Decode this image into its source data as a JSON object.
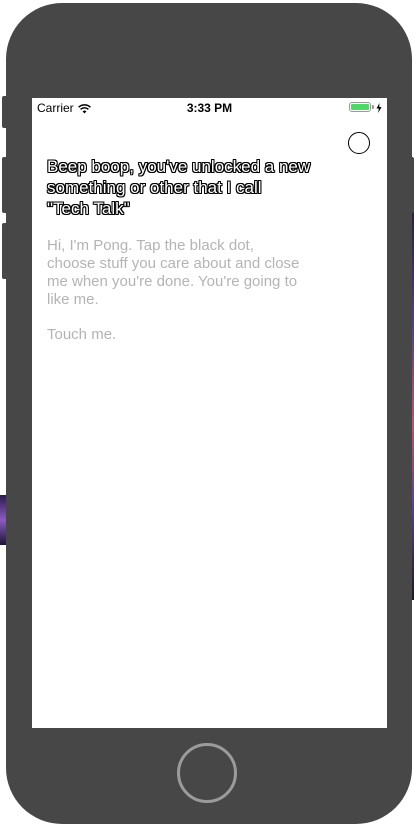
{
  "status_bar": {
    "carrier": "Carrier",
    "time": "3:33 PM",
    "wifi_icon": "wifi-icon",
    "battery_icon": "battery-full-icon",
    "charging_icon": "charging-bolt-icon",
    "battery_level": 1.0
  },
  "header": {
    "dot_button_icon": "circle-outline-icon"
  },
  "content": {
    "headline": "Beep boop, you've unlocked a new\n something or other that I call\n\"Tech Talk\"",
    "body": "Hi, I'm Pong. Tap the black dot,\n choose stuff you care about and close\n me when you're done. You're going to\n like me.",
    "touch_prompt": "Touch me."
  },
  "device": {
    "home_button_icon": "home-button-icon"
  },
  "colors": {
    "device_frame": "#474747",
    "screen_bg": "#ffffff",
    "body_text": "#b4b4b4",
    "battery_fill": "#4cd964",
    "home_ring": "#9b9b9b"
  }
}
